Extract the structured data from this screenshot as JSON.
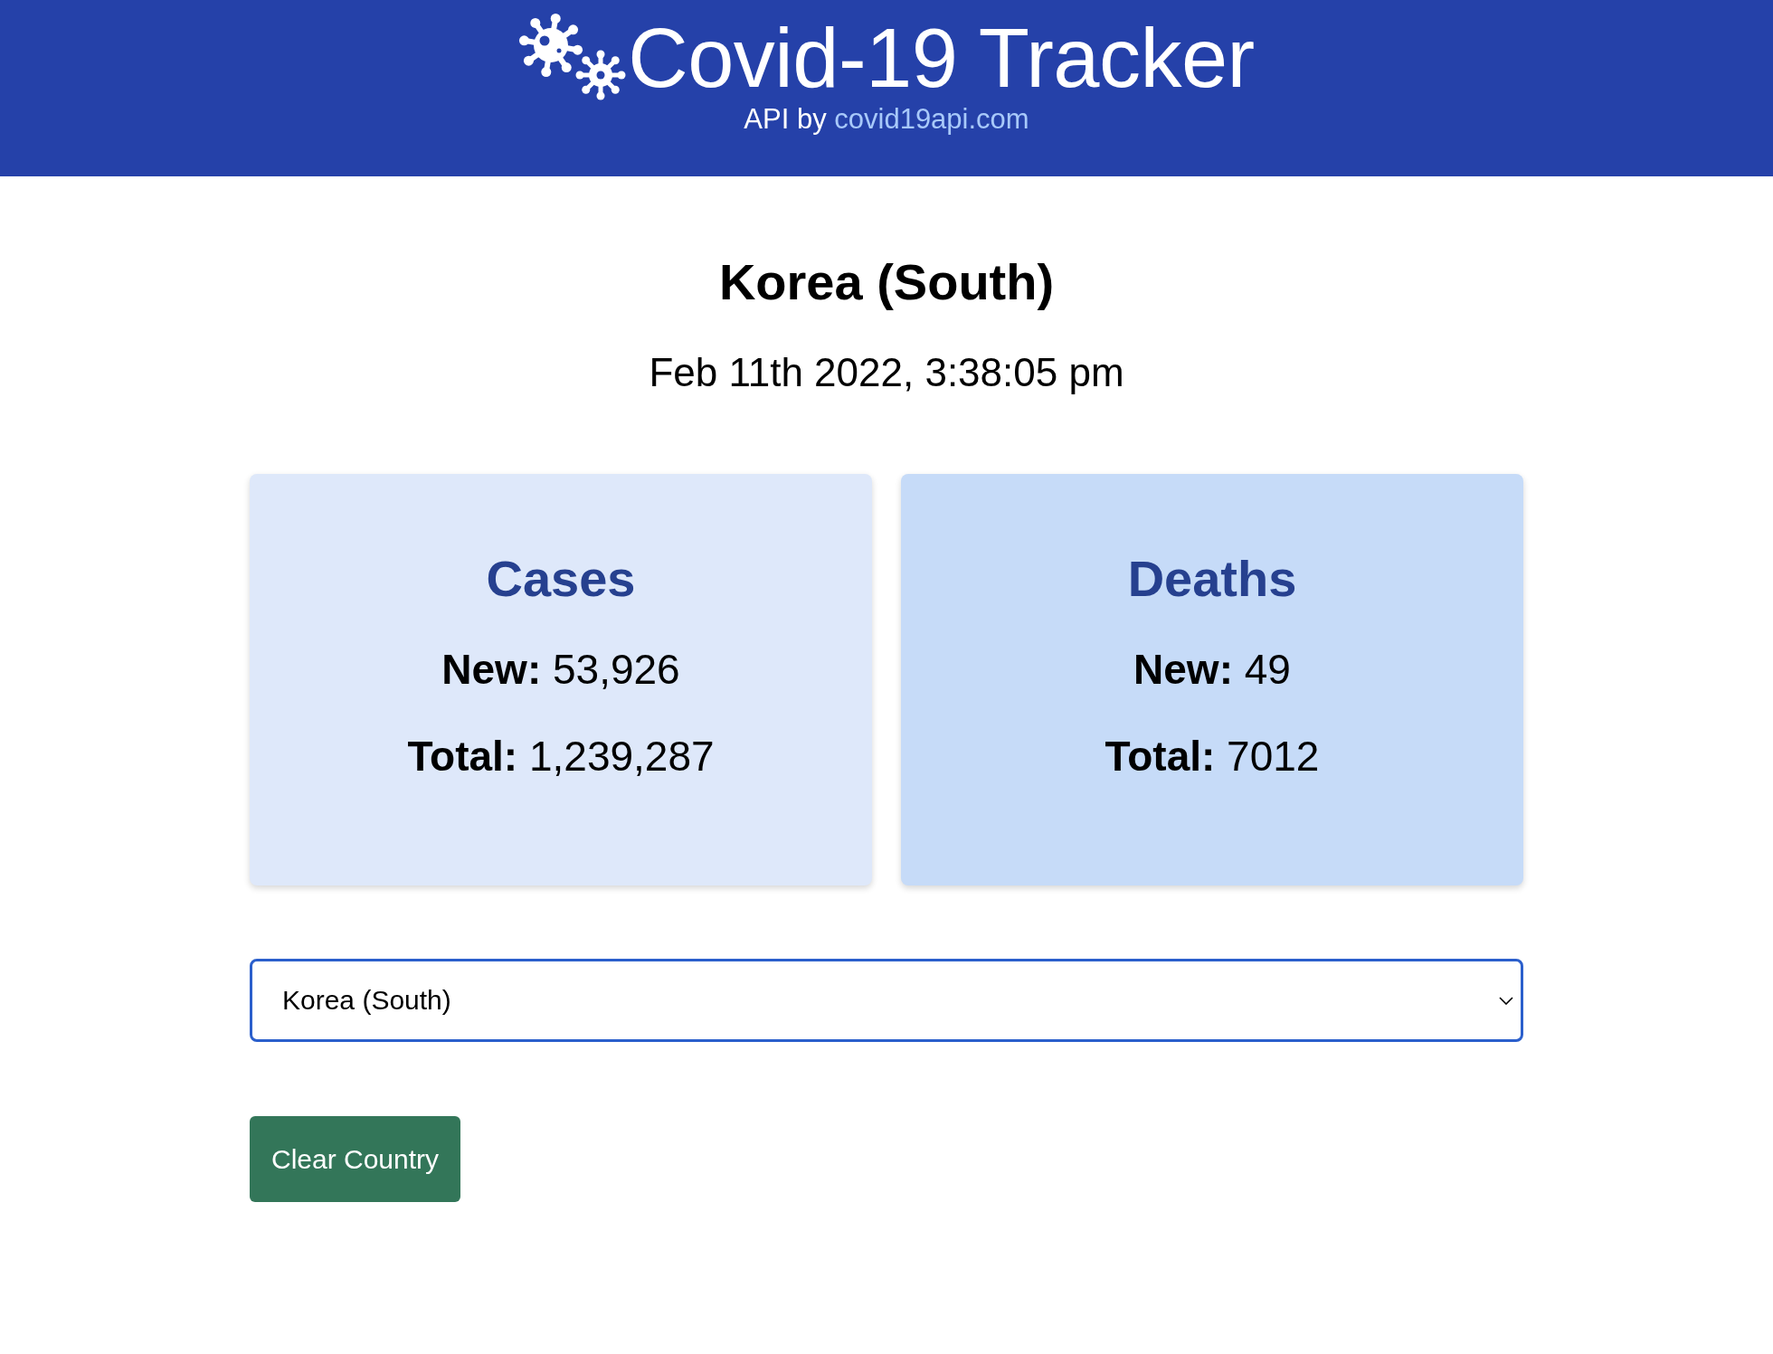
{
  "header": {
    "title": "Covid-19 Tracker",
    "credit": "API by",
    "link": "covid19api.com"
  },
  "country": "Korea (South)",
  "updated": "Feb 11th 2022, 3:38:05 pm",
  "cards": [
    {
      "title": "Cases",
      "color": "#dee8fa",
      "stats": [
        "**New:** 53,926",
        "**Total:** 1,239,287"
      ]
    },
    {
      "title": "Deaths",
      "color": "#c6dbf8",
      "stats": [
        "**New:** 49",
        "**Total:** 7012"
      ]
    }
  ],
  "country_select": {
    "value": "Korea (South)"
  },
  "clear_button": {
    "label": "Clear Country"
  }
}
